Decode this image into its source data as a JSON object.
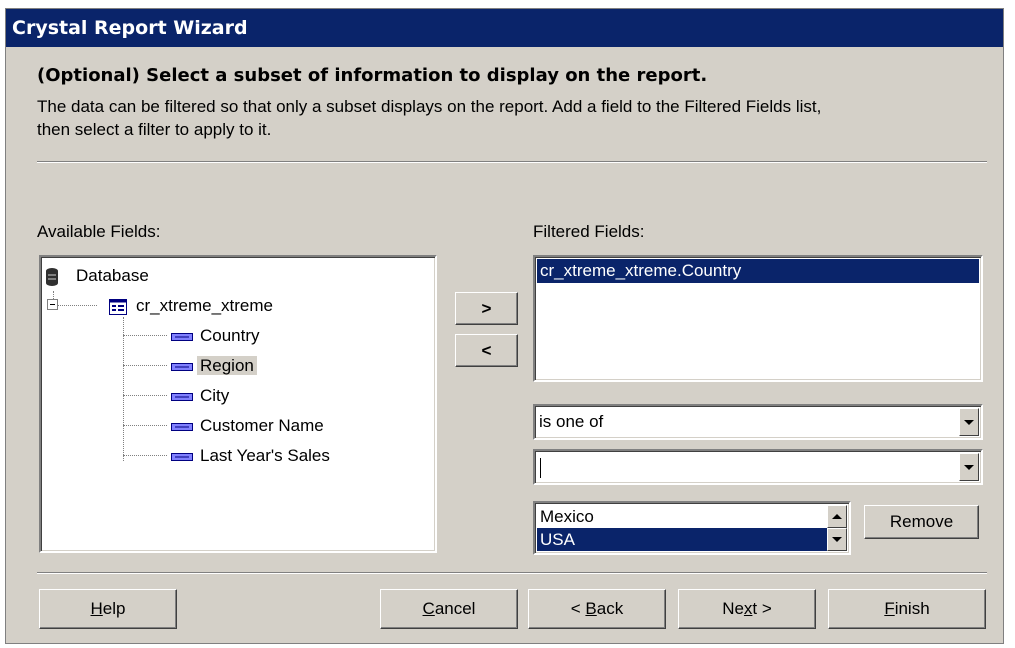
{
  "window": {
    "title": "Crystal Report Wizard"
  },
  "header": {
    "heading": "(Optional) Select a subset of information to display on the report.",
    "description_line1": "The data can be filtered so that only a subset displays on the report. Add a field to the Filtered Fields list,",
    "description_line2": "then select a filter to apply to it."
  },
  "available": {
    "label": "Available Fields:",
    "root": "Database",
    "table": "cr_xtreme_xtreme",
    "fields": [
      "Country",
      "Region",
      "City",
      "Customer Name",
      "Last Year's Sales"
    ],
    "selected_field": "Region"
  },
  "move": {
    "add_label": ">",
    "remove_label": "<"
  },
  "filtered": {
    "label": "Filtered Fields:",
    "items": [
      "cr_xtreme_xtreme.Country"
    ],
    "operator": "is one of",
    "value_input": "",
    "values": [
      "Mexico",
      "USA"
    ],
    "selected_value": "USA",
    "remove_label": "Remove"
  },
  "footer": {
    "help": {
      "label": "Help",
      "accel": "H"
    },
    "cancel": {
      "label": "Cancel",
      "accel": "C"
    },
    "back": {
      "label": "< Back",
      "accel": "B"
    },
    "next": {
      "label": "Next >",
      "accel": "x"
    },
    "finish": {
      "label": "Finish",
      "accel": "F"
    }
  },
  "colors": {
    "title_bar": "#0a246a",
    "dialog_bg": "#d4d0c8",
    "selection": "#0a246a"
  }
}
